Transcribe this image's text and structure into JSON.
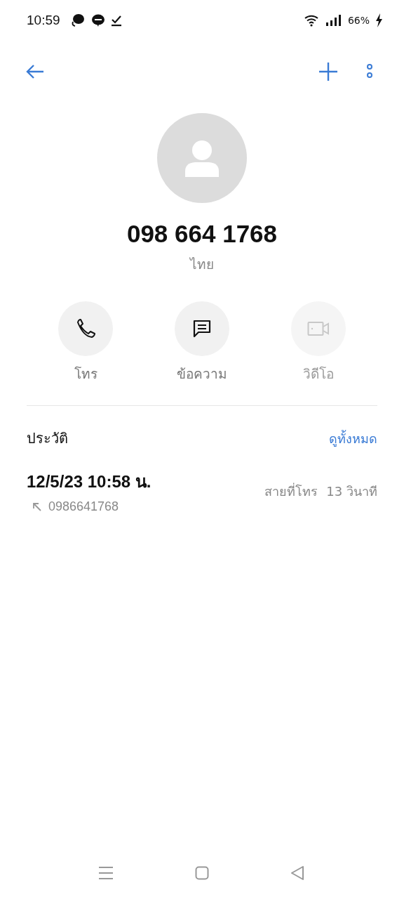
{
  "status_bar": {
    "time": "10:59",
    "battery": "66%",
    "charging": true
  },
  "contact": {
    "number": "098 664 1768",
    "region": "ไทย"
  },
  "actions": [
    {
      "kind": "call",
      "label": "โทร",
      "disabled": false
    },
    {
      "kind": "message",
      "label": "ข้อความ",
      "disabled": false
    },
    {
      "kind": "video",
      "label": "วิดีโอ",
      "disabled": true
    }
  ],
  "history": {
    "title": "ประวัติ",
    "see_all": "ดูทั้งหมด",
    "entries": [
      {
        "datetime": "12/5/23 10:58 น.",
        "kind": "outgoing",
        "number": "0986641768",
        "call_type": "สายที่โทร",
        "duration": "13 วินาที"
      }
    ]
  }
}
